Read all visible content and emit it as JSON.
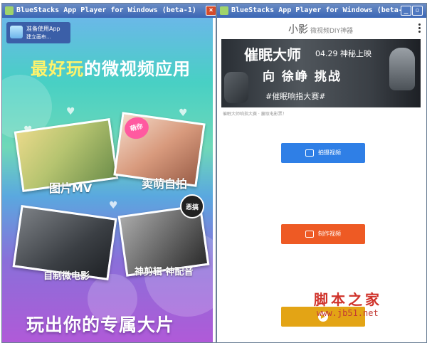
{
  "left_window": {
    "title": "BlueStacks App Player for Windows (beta-1)",
    "close_glyph": "×",
    "app_badge": {
      "line1": "准备使用App",
      "line2": "建立画布..."
    },
    "slogan": {
      "highlight": "最好玩",
      "rest": "的微视频应用"
    },
    "tiles": [
      {
        "caption": "图片MV"
      },
      {
        "caption": "卖萌自拍",
        "badge": "萌你"
      },
      {
        "caption": "自制微电影"
      },
      {
        "caption": "神剪辑 神配音",
        "badge": "恶搞"
      }
    ],
    "bottom_slogan": "玩出你的专属大片"
  },
  "right_window": {
    "title": "BlueStacks App Player for Windows (beta-1)",
    "logo": {
      "main": "小影",
      "sub": "微视频DIY神器"
    },
    "banner": {
      "title": "催眠大师",
      "date": "04.29 神秘上映",
      "headline": "向 徐峥 挑战",
      "hashtag": "#催眠响指大赛#",
      "subcaption": "催眠大师响指大赛 · 赢取电影票！"
    },
    "buttons": [
      {
        "label": "拍摄视频",
        "color": "#2f7fe6"
      },
      {
        "label": "制作视频",
        "color": "#ee5a24"
      },
      {
        "label": "",
        "color": "#e3a415"
      }
    ]
  },
  "watermark": {
    "text": "脚本之家",
    "url": "www.jb51.net"
  }
}
